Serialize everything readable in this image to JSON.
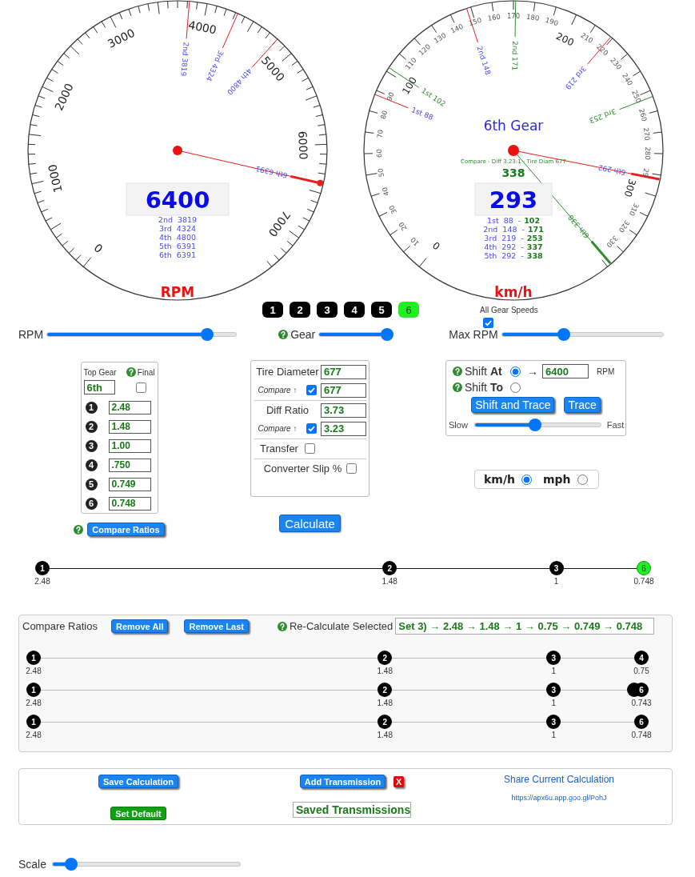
{
  "rpm_gauge": {
    "dial_labels": [
      "0",
      "1000",
      "2000",
      "3000",
      "4000",
      "5000",
      "6000",
      "7000"
    ],
    "shift_marks": [
      {
        "label": "2nd 3819"
      },
      {
        "label": "3rd 4324"
      },
      {
        "label": "4th 4800"
      }
    ],
    "needle": {
      "label": "6th 6391"
    },
    "reading": "6400",
    "gear_rpms": [
      "2nd 3819",
      "3rd 4324",
      "4th 4800",
      "5th 6391",
      "6th 6391"
    ],
    "unit": "RPM"
  },
  "speed_gauge": {
    "dial_labels": [
      "0",
      "10",
      "20",
      "30",
      "40",
      "50",
      "60",
      "70",
      "80",
      "90",
      "100",
      "110",
      "120",
      "130",
      "140",
      "150",
      "160",
      "170",
      "180",
      "190",
      "200",
      "210",
      "220",
      "230",
      "240",
      "250",
      "260",
      "270",
      "280",
      "29",
      "300",
      "310",
      "320",
      "330"
    ],
    "gear_title": "6th Gear",
    "marks": [
      {
        "kind": "shift",
        "label": "1st 88"
      },
      {
        "kind": "compare",
        "label": "1st 102"
      },
      {
        "kind": "shift",
        "label": "2nd 148"
      },
      {
        "kind": "compare",
        "label": "2nd 171"
      },
      {
        "kind": "shift",
        "label": "3rd 219"
      },
      {
        "kind": "compare",
        "label": "3rd 253"
      }
    ],
    "needles": [
      {
        "kind": "shift",
        "label": "6th 292"
      },
      {
        "kind": "compare",
        "label": "6th 338"
      }
    ],
    "compare_caption": "Compare - Diff 3.23:1 - Tire Diam 677",
    "compare_reading": "338",
    "reading": "293",
    "gear_speeds": [
      {
        "label": "1st 88 -",
        "compare": "102"
      },
      {
        "label": "2nd 148 -",
        "compare": "171"
      },
      {
        "label": "3rd 219 -",
        "compare": "253"
      },
      {
        "label": "4th 292 -",
        "compare": "337"
      },
      {
        "label": "5th 292 -",
        "compare": "338"
      }
    ],
    "unit": "km/h"
  },
  "gear_buttons": [
    {
      "label": "1",
      "selected": false
    },
    {
      "label": "2",
      "selected": false
    },
    {
      "label": "3",
      "selected": false
    },
    {
      "label": "4",
      "selected": false
    },
    {
      "label": "5",
      "selected": false
    },
    {
      "label": "6",
      "selected": true
    }
  ],
  "all_gear_speeds": {
    "label": "All Gear Speeds",
    "checked": true
  },
  "sliders": [
    {
      "label": "RPM",
      "level": 0.87
    },
    {
      "label": "Gear",
      "help": true,
      "level": 1
    },
    {
      "label": "Max RPM",
      "level": 0.374
    }
  ],
  "ratio_panel": {
    "top_gear_label": "Top Gear",
    "top_gear": "6th",
    "final": {
      "label": "Final",
      "help": true,
      "checked": false
    },
    "ratios": [
      {
        "number": "1",
        "value": "2.48"
      },
      {
        "number": "2",
        "value": "1.48"
      },
      {
        "number": "3",
        "value": "1.00"
      },
      {
        "number": "4",
        "value": ".750"
      },
      {
        "number": "5",
        "value": "0.749"
      },
      {
        "number": "6",
        "value": "0.748"
      }
    ]
  },
  "compare_ratios_button": {
    "label": "Compare Ratios",
    "help": true
  },
  "tire_panel": {
    "rows": [
      {
        "kind": "field",
        "label": "Tire Diameter",
        "value": "677"
      },
      {
        "kind": "compare",
        "label": "Compare ↑",
        "checked": true,
        "value": "677"
      },
      {
        "kind": "field",
        "label": "Diff Ratio",
        "value": "3.73"
      },
      {
        "kind": "compare",
        "label": "Compare ↑",
        "checked": true,
        "value": "3.23"
      },
      {
        "kind": "toggle",
        "label": "Transfer",
        "checked": false
      },
      {
        "kind": "wide_toggle",
        "label": "Converter Slip %",
        "checked": false
      }
    ]
  },
  "calculate_button": "Calculate",
  "shift_panel": {
    "options": [
      {
        "label": "Shift **At**",
        "help": true,
        "selected": true,
        "arrow": "→",
        "rpm": "6400",
        "unit": "RPM"
      },
      {
        "label": "Shift **To**",
        "help": true,
        "selected": false
      }
    ],
    "buttons": [
      "Shift and Trace",
      "Trace"
    ],
    "trace_speed": {
      "slow": "Slow",
      "fast": "Fast",
      "level": 0.48
    }
  },
  "units": [
    {
      "label": "km/h",
      "selected": true
    },
    {
      "label": "mph",
      "selected": false
    }
  ],
  "ratio_line": {
    "nodes": [
      {
        "number": "1",
        "value": "2.48",
        "level": 0,
        "selected": false
      },
      {
        "number": "2",
        "value": "1.48",
        "level": 0.5774,
        "selected": false
      },
      {
        "number": "3",
        "value": "1",
        "level": 0.8545,
        "selected": false
      },
      {
        "number": "6",
        "value": "0.748",
        "level": 1,
        "selected": true
      }
    ]
  },
  "compare_panel": {
    "title": "Compare Ratios",
    "buttons": [
      "Remove All",
      "Remove Last"
    ],
    "recalculate": {
      "label": "Re-Calculate Selected",
      "help": true
    },
    "selected_set": "Set 3) → 2.48 → 1.48 → 1 → 0.75 → 0.749 → 0.748",
    "sets": [
      {
        "nodes": [
          {
            "number": "1",
            "value": "2.48",
            "level": 0
          },
          {
            "number": "2",
            "value": "1.48",
            "level": 0.578
          },
          {
            "number": "3",
            "value": "1",
            "level": 0.8555
          },
          {
            "number": "4",
            "value": "0.75",
            "level": 1
          }
        ]
      },
      {
        "nodes": [
          {
            "number": "1",
            "value": "2.48",
            "level": 0
          },
          {
            "number": "2",
            "value": "1.48",
            "level": 0.578
          },
          {
            "number": "3",
            "value": "1",
            "level": 0.8555
          },
          {
            "level": 0.988
          },
          {
            "number": "6",
            "value": "0.743",
            "level": 1
          }
        ]
      },
      {
        "nodes": [
          {
            "number": "1",
            "value": "2.48",
            "level": 0
          },
          {
            "number": "2",
            "value": "1.48",
            "level": 0.578
          },
          {
            "number": "3",
            "value": "1",
            "level": 0.8555
          },
          {
            "number": "6",
            "value": "0.748",
            "level": 1
          }
        ]
      }
    ]
  },
  "save_panel": {
    "save_button": "Save Calculation",
    "set_default_button": "Set Default",
    "add_button": "Add Transmission",
    "delete_button": "X",
    "saved_select": "Saved Transmissions",
    "share_link": "Share Current Calculation",
    "share_url": "https://apx6u.app.goo.gl/PohJ"
  },
  "scale": {
    "label": "Scale",
    "level": 0.073
  }
}
